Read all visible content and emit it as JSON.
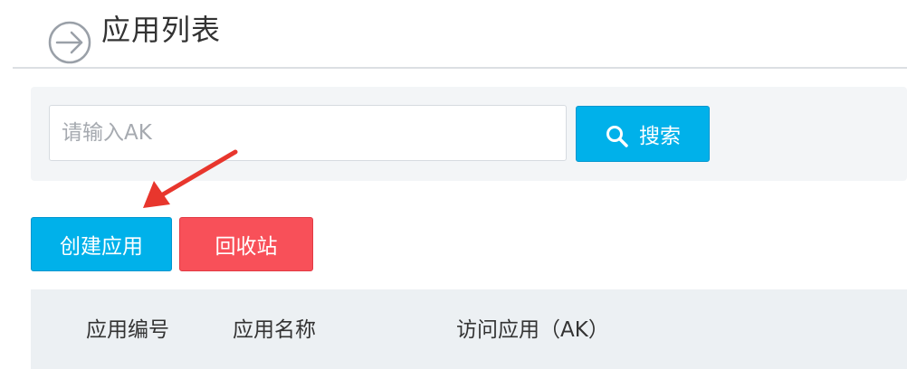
{
  "header": {
    "title": "应用列表",
    "icon": "arrow-right-circle-icon"
  },
  "search": {
    "placeholder": "请输入AK",
    "value": "",
    "button_label": "搜索",
    "button_icon": "search-icon"
  },
  "actions": {
    "create_label": "创建应用",
    "recycle_label": "回收站"
  },
  "table": {
    "columns": [
      "应用编号",
      "应用名称",
      "访问应用（AK）"
    ]
  },
  "colors": {
    "primary": "#00b1ea",
    "danger": "#f85059",
    "annotation": "#e8362d",
    "panel_bg": "#f3f5f7",
    "table_header_bg": "#ecf0f3"
  }
}
